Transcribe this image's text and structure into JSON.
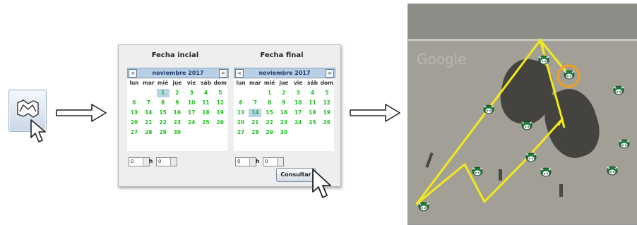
{
  "dialog": {
    "start": {
      "title": "Fecha incial",
      "month": "noviembre 2017",
      "weekdays": [
        "lun",
        "mar",
        "mié",
        "jue",
        "vie",
        "sáb",
        "dom"
      ],
      "days": [
        "1",
        "2",
        "3",
        "4",
        "5",
        "6",
        "7",
        "8",
        "9",
        "10",
        "11",
        "12",
        "13",
        "14",
        "15",
        "16",
        "17",
        "18",
        "19",
        "20",
        "21",
        "22",
        "23",
        "24",
        "25",
        "26",
        "27",
        "28",
        "29",
        "30"
      ],
      "selected_day": "1",
      "hour": "0",
      "minute": "0",
      "hour_suffix": "h"
    },
    "end": {
      "title": "Fecha final",
      "month": "noviembre 2017",
      "weekdays": [
        "lun",
        "mar",
        "mié",
        "jue",
        "vie",
        "sáb",
        "dom"
      ],
      "days": [
        "1",
        "2",
        "3",
        "4",
        "5",
        "6",
        "7",
        "8",
        "9",
        "10",
        "11",
        "12",
        "13",
        "14",
        "15",
        "16",
        "17",
        "18",
        "19",
        "20",
        "21",
        "22",
        "23",
        "24",
        "25",
        "26",
        "27",
        "28",
        "29",
        "30"
      ],
      "selected_day": "14",
      "hour": "0",
      "minute": "0",
      "hour_suffix": "h"
    },
    "consult_label": "Consultar",
    "nav_prev": "<",
    "nav_next": ">"
  },
  "map": {
    "watermark": "Google",
    "track_color": "#f2ea1c",
    "highlight_color": "#f0a020",
    "cow_icon": "cow-icon"
  },
  "icons": {
    "route_button": "route-map-icon",
    "cursor": "mouse-pointer-icon",
    "arrow": "right-arrow-icon"
  },
  "colors": {
    "weekday_green": "#22c122",
    "calendar_header": "#b8cfe5",
    "selected_day_bg": "#b8d3ea"
  }
}
